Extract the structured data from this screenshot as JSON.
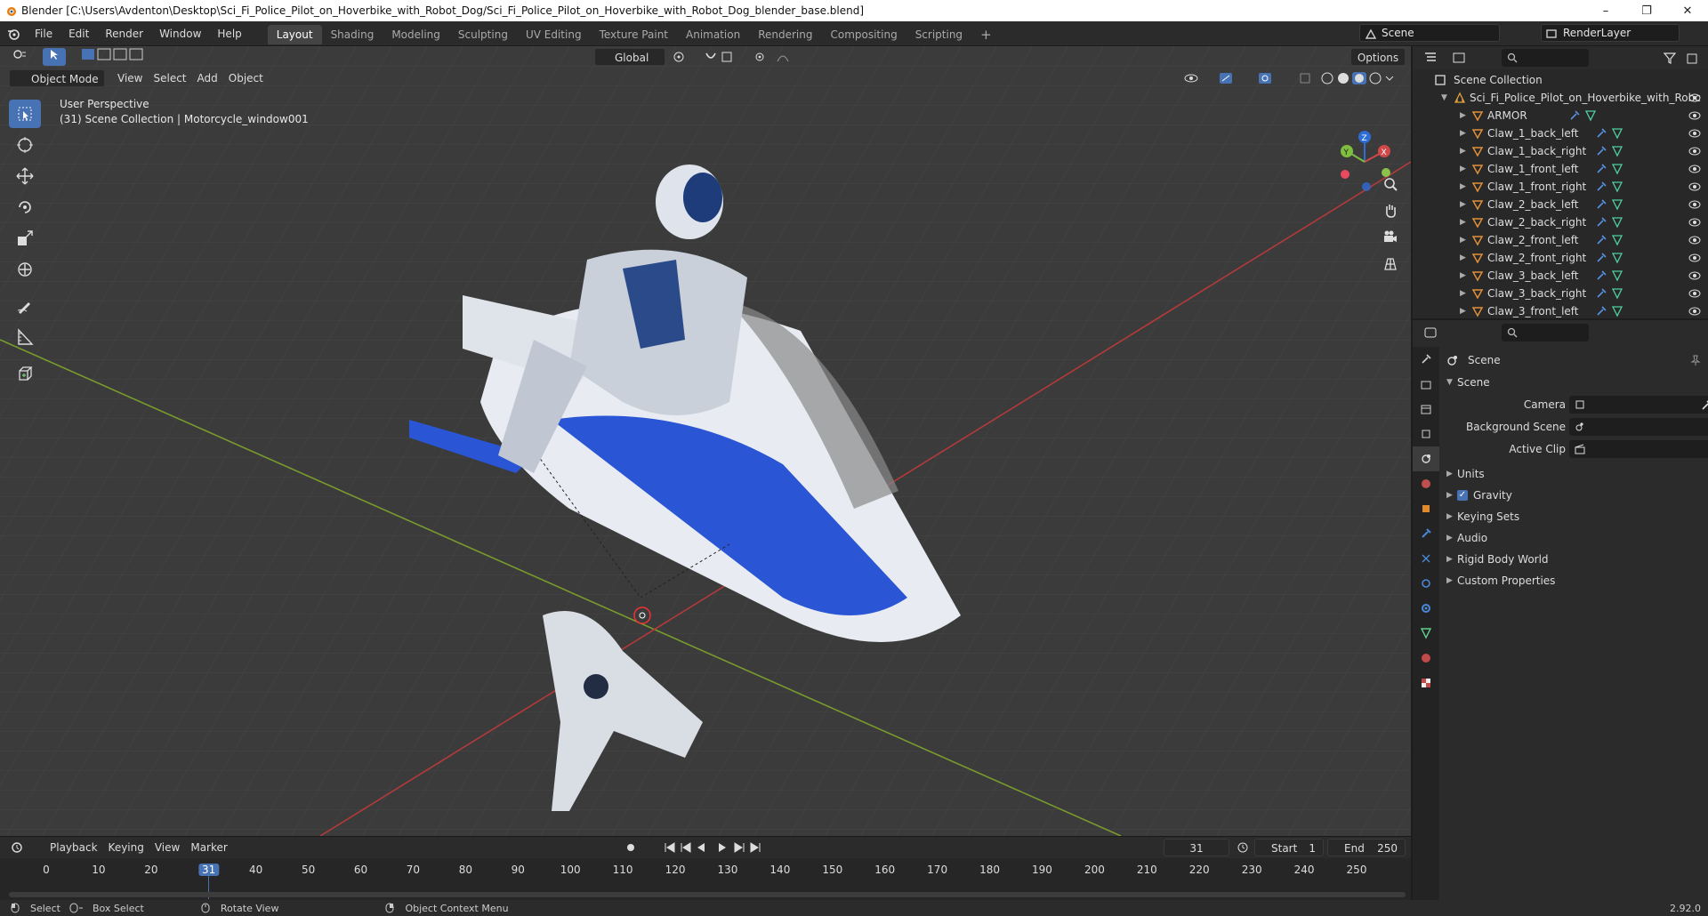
{
  "window": {
    "title": "Blender [C:\\Users\\Avdenton\\Desktop\\Sci_Fi_Police_Pilot_on_Hoverbike_with_Robot_Dog/Sci_Fi_Police_Pilot_on_Hoverbike_with_Robot_Dog_blender_base.blend]",
    "minimize": "–",
    "maximize": "❐",
    "close": "✕"
  },
  "menu": [
    "File",
    "Edit",
    "Render",
    "Window",
    "Help"
  ],
  "workspaces": [
    "Layout",
    "Shading",
    "Modeling",
    "Sculpting",
    "UV Editing",
    "Texture Paint",
    "Animation",
    "Rendering",
    "Compositing",
    "Scripting"
  ],
  "active_workspace": "Layout",
  "scene_field": "Scene",
  "renderlayer_field": "RenderLayer",
  "viewport": {
    "mode": "Object Mode",
    "menus": [
      "View",
      "Select",
      "Add",
      "Object"
    ],
    "orientation": "Global",
    "options": "Options",
    "perspective_label": "User Perspective",
    "collection_label": "(31) Scene Collection | Motorcycle_window001",
    "gizmo": {
      "x": "X",
      "y": "Y",
      "z": "Z"
    },
    "colors": {
      "grid_bg": "#3b3b3b",
      "x_axis": "#b33a3a",
      "y_axis": "#7a9a2e",
      "accent": "#4772b3"
    }
  },
  "outliner": {
    "root": "Scene Collection",
    "collection": "Sci_Fi_Police_Pilot_on_Hoverbike_with_Robc",
    "items": [
      "ARMOR",
      "Claw_1_back_left",
      "Claw_1_back_right",
      "Claw_1_front_left",
      "Claw_1_front_right",
      "Claw_2_back_left",
      "Claw_2_back_right",
      "Claw_2_front_left",
      "Claw_2_front_right",
      "Claw_3_back_left",
      "Claw_3_back_right",
      "Claw_3_front_left"
    ]
  },
  "properties": {
    "context": "Scene",
    "panel": "Scene",
    "fields": [
      {
        "label": "Camera"
      },
      {
        "label": "Background Scene"
      },
      {
        "label": "Active Clip"
      }
    ],
    "subpanels": [
      "Units",
      "Gravity",
      "Keying Sets",
      "Audio",
      "Rigid Body World",
      "Custom Properties"
    ],
    "gravity_checked": true
  },
  "timeline": {
    "menus": [
      "Playback",
      "Keying",
      "View",
      "Marker"
    ],
    "current_frame": "31",
    "start_label": "Start",
    "start": "1",
    "end_label": "End",
    "end": "250",
    "ticks": [
      "0",
      "10",
      "20",
      "31",
      "40",
      "50",
      "60",
      "70",
      "80",
      "90",
      "100",
      "110",
      "120",
      "130",
      "140",
      "150",
      "160",
      "170",
      "180",
      "190",
      "200",
      "210",
      "220",
      "230",
      "240",
      "250"
    ]
  },
  "status": {
    "select": "Select",
    "box_select": "Box Select",
    "rotate": "Rotate View",
    "context_menu": "Object Context Menu",
    "version": "2.92.0"
  }
}
